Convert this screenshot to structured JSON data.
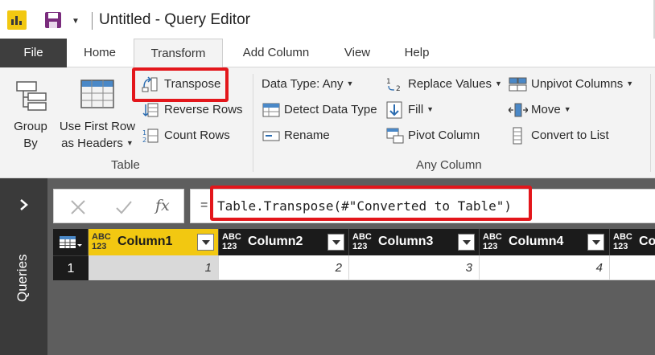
{
  "window": {
    "title": "Untitled - Query Editor"
  },
  "tabs": {
    "file": "File",
    "home": "Home",
    "transform": "Transform",
    "add_column": "Add Column",
    "view": "View",
    "help": "Help"
  },
  "ribbon": {
    "table_group": {
      "label": "Table",
      "group_by": [
        "Group",
        "By"
      ],
      "first_row_headers": [
        "Use First Row",
        "as Headers"
      ],
      "transpose": "Transpose",
      "reverse_rows": "Reverse Rows",
      "count_rows": "Count Rows"
    },
    "any_column_group": {
      "label": "Any Column",
      "data_type": "Data Type: Any",
      "detect_data_type": "Detect Data Type",
      "rename": "Rename",
      "replace_values": "Replace Values",
      "fill": "Fill",
      "pivot_column": "Pivot Column",
      "unpivot_columns": "Unpivot Columns",
      "move": "Move",
      "convert_to_list": "Convert to List"
    }
  },
  "queries_pane": {
    "label": "Queries"
  },
  "formula_bar": {
    "equals": "=",
    "formula": "Table.Transpose(#\"Converted to Table\")",
    "fx_label": "fx"
  },
  "grid": {
    "type_label_top": "ABC",
    "type_label_bottom": "123",
    "columns": [
      "Column1",
      "Column2",
      "Column3",
      "Column4",
      "Co"
    ],
    "rows": [
      {
        "row_number": "1",
        "cells": [
          "1",
          "2",
          "3",
          "4"
        ]
      }
    ]
  },
  "colors": {
    "accent_yellow": "#f2c811",
    "highlight_red": "#e3161b",
    "dark_pane": "#3a3a3a",
    "workspace": "#5e5e5e"
  }
}
